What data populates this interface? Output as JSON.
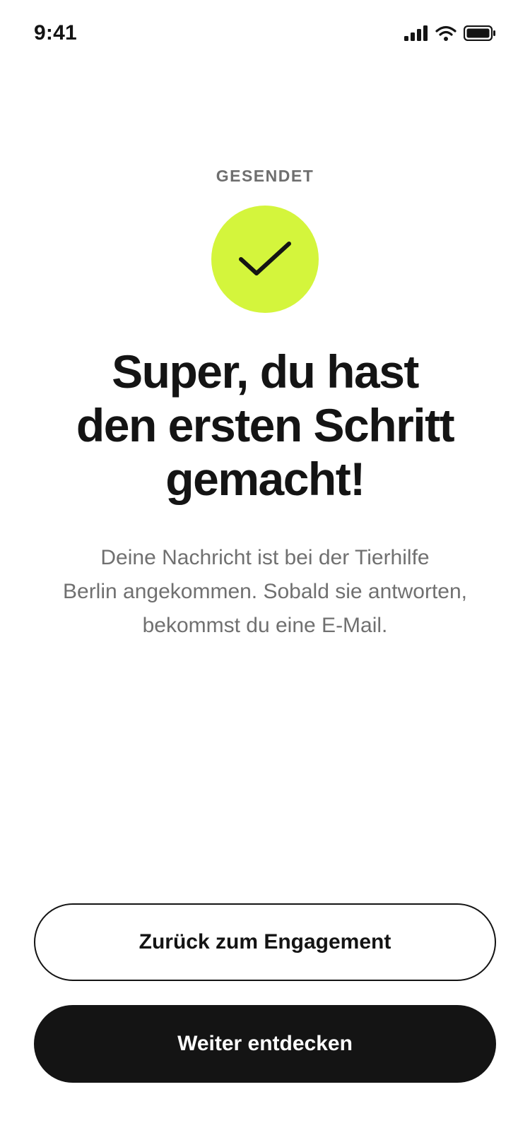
{
  "status_bar": {
    "time": "9:41",
    "icons": [
      "cellular-signal-icon",
      "wifi-icon",
      "battery-icon"
    ]
  },
  "confirmation": {
    "overline": "GESENDET",
    "icon": "checkmark-icon",
    "accent_color": "#d4f53c",
    "headline_lines": [
      "Super, du hast",
      "den ersten Schritt",
      "gemacht!"
    ],
    "body_lines": [
      "Deine Nachricht ist bei der Tierhilfe",
      "Berlin angekommen. Sobald sie antworten,",
      "bekommst du eine E-Mail."
    ]
  },
  "actions": {
    "secondary_label": "Zurück zum Engagement",
    "primary_label": "Weiter entdecken",
    "primary_color": "#141414"
  }
}
